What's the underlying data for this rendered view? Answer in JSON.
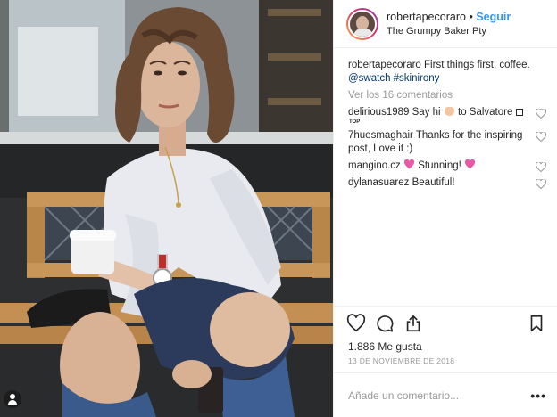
{
  "post": {
    "photo": {
      "image_name": "woman-with-coffee-on-bench-photo"
    },
    "header": {
      "username": "robertapecoraro",
      "separator": "•",
      "follow_label": "Seguir",
      "location": "The Grumpy Baker Pty"
    },
    "caption": {
      "username": "robertapecoraro",
      "text": "First things first, coffee.",
      "tags": "@swatch #skinirony"
    },
    "view_all_comments": "Ver los 16 comentarios",
    "comments": [
      {
        "user": "delirious1989",
        "text_before": "Say hi",
        "text_after": "to Salvatore",
        "badge": "TOP"
      },
      {
        "user": "7huesmaghair",
        "text": "Thanks for the inspiring post, Love it :)"
      },
      {
        "user": "mangino.cz",
        "text": "Stunning!"
      },
      {
        "user": "dylanasuarez",
        "text": "Beautiful!"
      }
    ],
    "likes": "1.886 Me gusta",
    "date": "13 DE NOVIEMBRE DE 2018",
    "add_comment_placeholder": "Añade un comentario...",
    "more_label": "•••"
  },
  "colors": {
    "accent": "#3897f0",
    "text": "#262626",
    "muted": "#999999",
    "tag": "#003569"
  },
  "icons": [
    "heart-icon",
    "comment-icon",
    "share-icon",
    "bookmark-icon",
    "user-icon"
  ]
}
